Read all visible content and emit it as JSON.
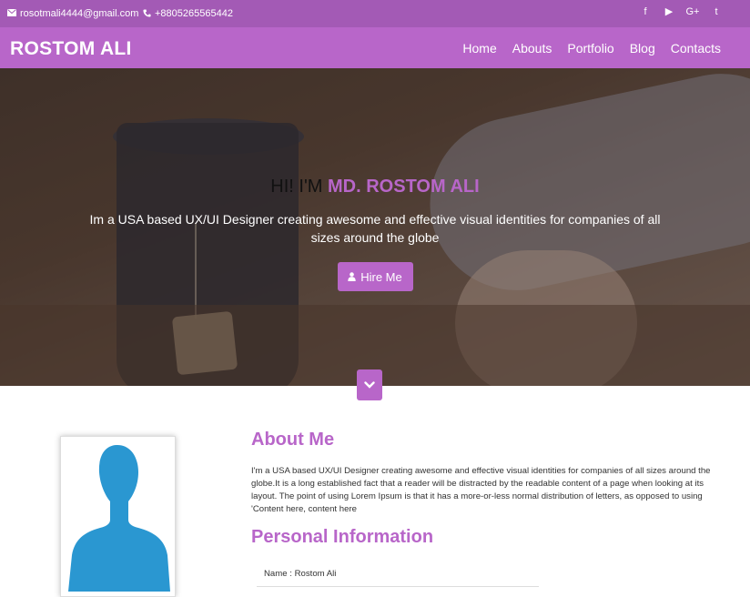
{
  "topbar": {
    "email": "rosotmali4444@gmail.com",
    "phone": "+8805265565442",
    "social": [
      {
        "icon": "facebook-icon",
        "glyph": "f"
      },
      {
        "icon": "youtube-icon",
        "glyph": "▶"
      },
      {
        "icon": "google-plus-icon",
        "glyph": "G+"
      },
      {
        "icon": "twitter-icon",
        "glyph": "t"
      }
    ]
  },
  "navbar": {
    "brand": "ROSTOM ALI",
    "items": [
      "Home",
      "Abouts",
      "Portfolio",
      "Blog",
      "Contacts"
    ]
  },
  "hero": {
    "greeting": "HI! I'M",
    "name": "MD. ROSTOM ALI",
    "tagline": "Im a USA based UX/UI Designer creating awesome and effective visual identities for companies of all sizes around the globe",
    "button": "Hire Me"
  },
  "about": {
    "title": "About Me",
    "text": "I'm a USA based UX/UI Designer creating awesome and effective visual identities for companies of all sizes around the globe.It is a long established fact that a reader will be distracted by the readable content of a page when looking at its layout. The point of using Lorem Ipsum is that it has a more-or-less normal distribution of letters, as opposed to using 'Content here, content here"
  },
  "personal": {
    "title": "Personal Information",
    "rows": [
      {
        "label": "Name : Rostom Ali"
      }
    ]
  },
  "colors": {
    "topbar": "#a35ab5",
    "navbar": "#b866c9",
    "accent": "#b866c9",
    "avatar": "#2a97d1"
  }
}
